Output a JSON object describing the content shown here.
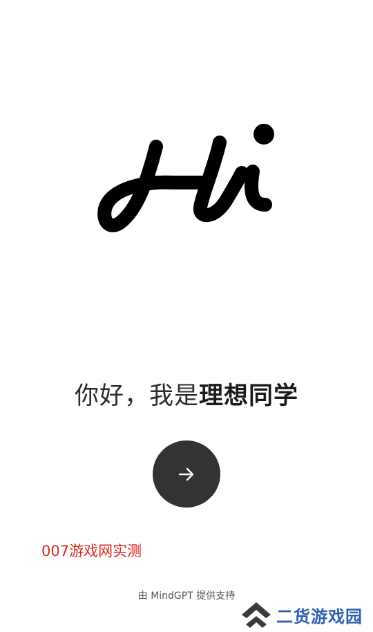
{
  "hero": {
    "logo_text": "Hi"
  },
  "greeting": {
    "prefix": "你好，我是",
    "name": "理想同学"
  },
  "start_button": {
    "icon": "arrow-right-icon"
  },
  "watermarks": {
    "red_label": "007游戏网实测",
    "brand_label": "二货游戏园",
    "brand_icon": "double-chevron-up-icon"
  },
  "footer": {
    "credit": "由 MindGPT 提供支持"
  },
  "colors": {
    "button_bg": "#333333",
    "red_watermark": "#d9281c",
    "brand_blue": "#2f5fb0",
    "logo_black": "#000000"
  }
}
